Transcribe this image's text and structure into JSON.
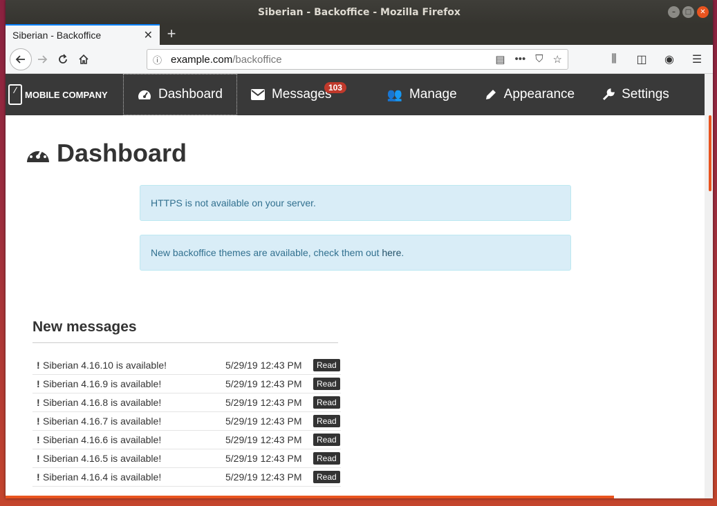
{
  "window": {
    "title": "Siberian - Backoffice - Mozilla Firefox"
  },
  "browser": {
    "tab_title": "Siberian - Backoffice",
    "url_host": "example.com",
    "url_path": "/backoffice"
  },
  "app": {
    "brand": "MOBILE COMPANY",
    "menu": [
      {
        "label": "Dashboard",
        "icon": "dashboard-icon"
      },
      {
        "label": "Messages",
        "icon": "envelope-icon",
        "badge": "103"
      },
      {
        "label": "Manage",
        "icon": "users-icon"
      },
      {
        "label": "Appearance",
        "icon": "pencil-icon"
      },
      {
        "label": "Settings",
        "icon": "wrench-icon"
      }
    ]
  },
  "page": {
    "title": "Dashboard",
    "alerts": [
      {
        "text": "HTTPS is not available on your server."
      },
      {
        "text": "New backoffice themes are available, check them out ",
        "link": "here",
        "suffix": "."
      }
    ],
    "messages_title": "New messages",
    "read_label": "Read",
    "messages": [
      {
        "text": "Siberian 4.16.10 is available!",
        "date": "5/29/19 12:43 PM"
      },
      {
        "text": "Siberian 4.16.9 is available!",
        "date": "5/29/19 12:43 PM"
      },
      {
        "text": "Siberian 4.16.8 is available!",
        "date": "5/29/19 12:43 PM"
      },
      {
        "text": "Siberian 4.16.7 is available!",
        "date": "5/29/19 12:43 PM"
      },
      {
        "text": "Siberian 4.16.6 is available!",
        "date": "5/29/19 12:43 PM"
      },
      {
        "text": "Siberian 4.16.5 is available!",
        "date": "5/29/19 12:43 PM"
      },
      {
        "text": "Siberian 4.16.4 is available!",
        "date": "5/29/19 12:43 PM"
      }
    ]
  }
}
